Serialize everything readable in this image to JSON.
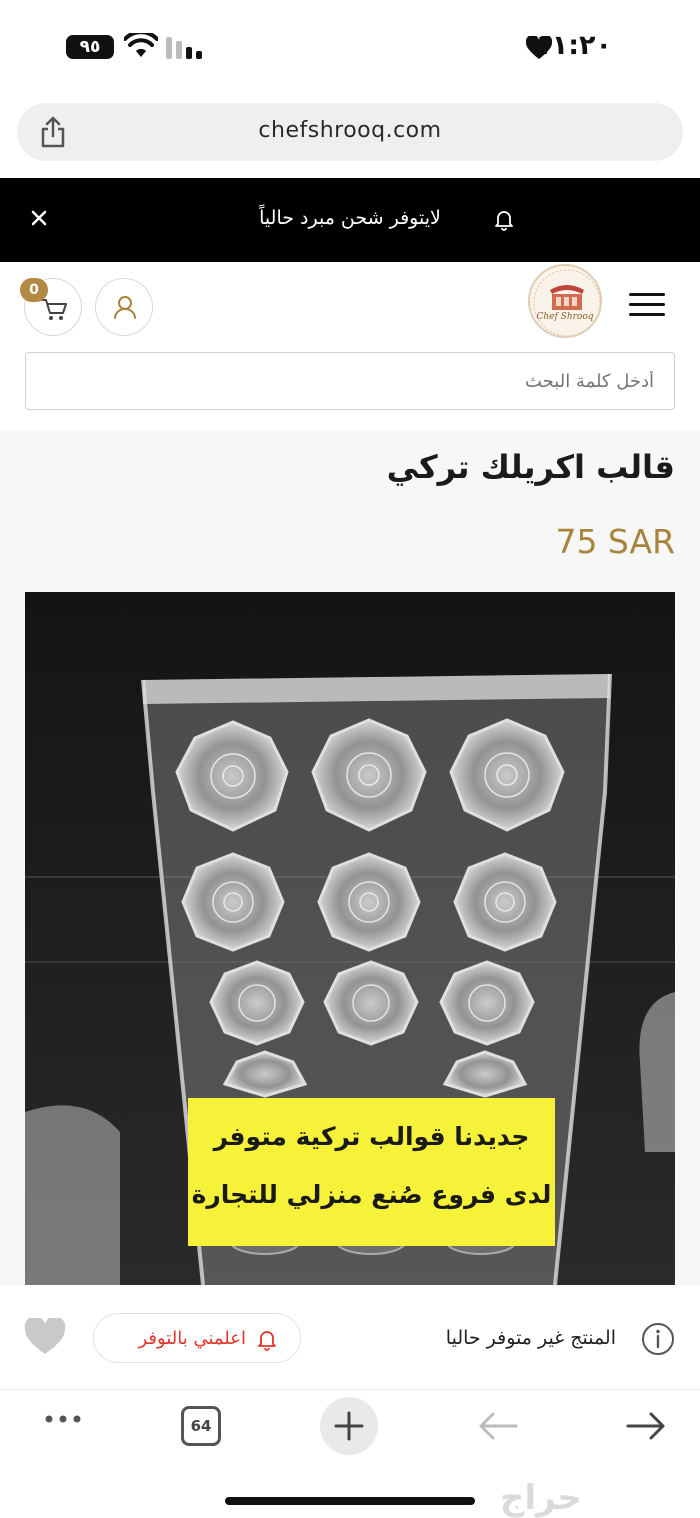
{
  "status_bar": {
    "time": "١١:٢٠",
    "battery": "٩٥"
  },
  "browser": {
    "url": "chefshrooq.com",
    "tab_count": "64"
  },
  "announcement": {
    "text": "لايتوفر شحن مبرد حالياً"
  },
  "header": {
    "cart_count": "0",
    "logo_text": "Chef Shrooq"
  },
  "search": {
    "placeholder": "أدخل كلمة البحث"
  },
  "product": {
    "title": "قالب اكريلك تركي",
    "price": "75 SAR",
    "image_caption_line1": "جديدنا قوالب تركية متوفر",
    "image_caption_line2": "لدى فروع صُنع منزلي للتجارة"
  },
  "availability": {
    "status_text": "المنتج غير متوفر حاليا",
    "notify_label": "اعلمني بالتوفر"
  },
  "watermark": "حراج",
  "colors": {
    "accent_gold": "#a8843d",
    "badge_gold": "#b28a43",
    "notify_red": "#e0342c"
  }
}
